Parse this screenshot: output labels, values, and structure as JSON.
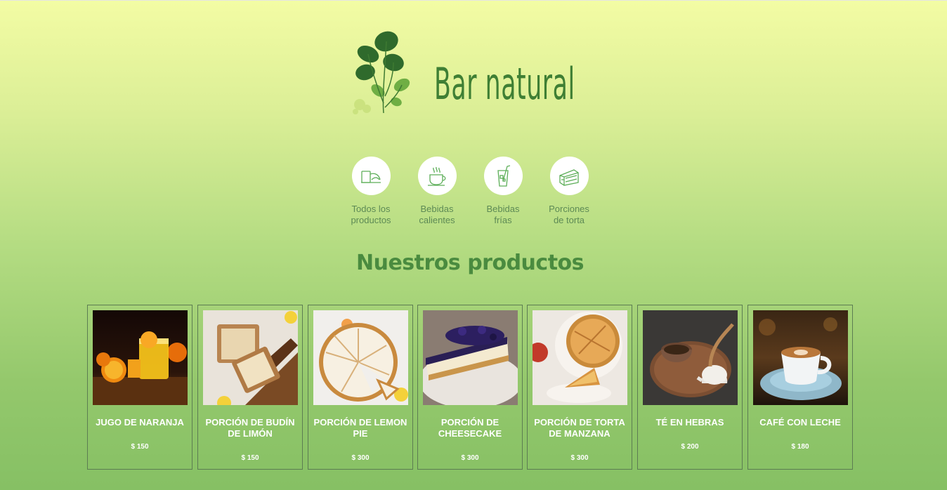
{
  "brand": {
    "name": "Bar natural",
    "logo_icon": "monstera-plant-icon"
  },
  "categories": [
    {
      "label": "Todos los productos",
      "line1": "Todos los",
      "line2": "productos",
      "icon": "croissant-icon"
    },
    {
      "label": "Bebidas calientes",
      "line1": "Bebidas",
      "line2": "calientes",
      "icon": "coffee-cup-icon"
    },
    {
      "label": "Bebidas frías",
      "line1": "Bebidas",
      "line2": "frías",
      "icon": "cold-drink-icon"
    },
    {
      "label": "Porciones de torta",
      "line1": "Porciones",
      "line2": "de torta",
      "icon": "cake-slice-icon"
    }
  ],
  "section": {
    "title": "Nuestros productos"
  },
  "products": [
    {
      "name": "Jugo de naranja",
      "price": "$ 150",
      "image": "orange-juice-photo"
    },
    {
      "name": "Porción de budín de limón",
      "price": "$ 150",
      "image": "lemon-cake-photo"
    },
    {
      "name": "Porción de lemon pie",
      "price": "$ 300",
      "image": "lemon-pie-photo"
    },
    {
      "name": "Porción de cheesecake",
      "price": "$ 300",
      "image": "cheesecake-photo"
    },
    {
      "name": "Porción de torta de manzana",
      "price": "$ 300",
      "image": "apple-pie-photo"
    },
    {
      "name": "Té en hebras",
      "price": "$ 200",
      "image": "loose-tea-photo"
    },
    {
      "name": "Café con leche",
      "price": "$ 180",
      "image": "latte-photo"
    }
  ],
  "colors": {
    "accent": "#4a8b3f",
    "brand_text": "#3f7f34",
    "category_text": "#5d8a55",
    "card_border": "#5c7d52"
  }
}
